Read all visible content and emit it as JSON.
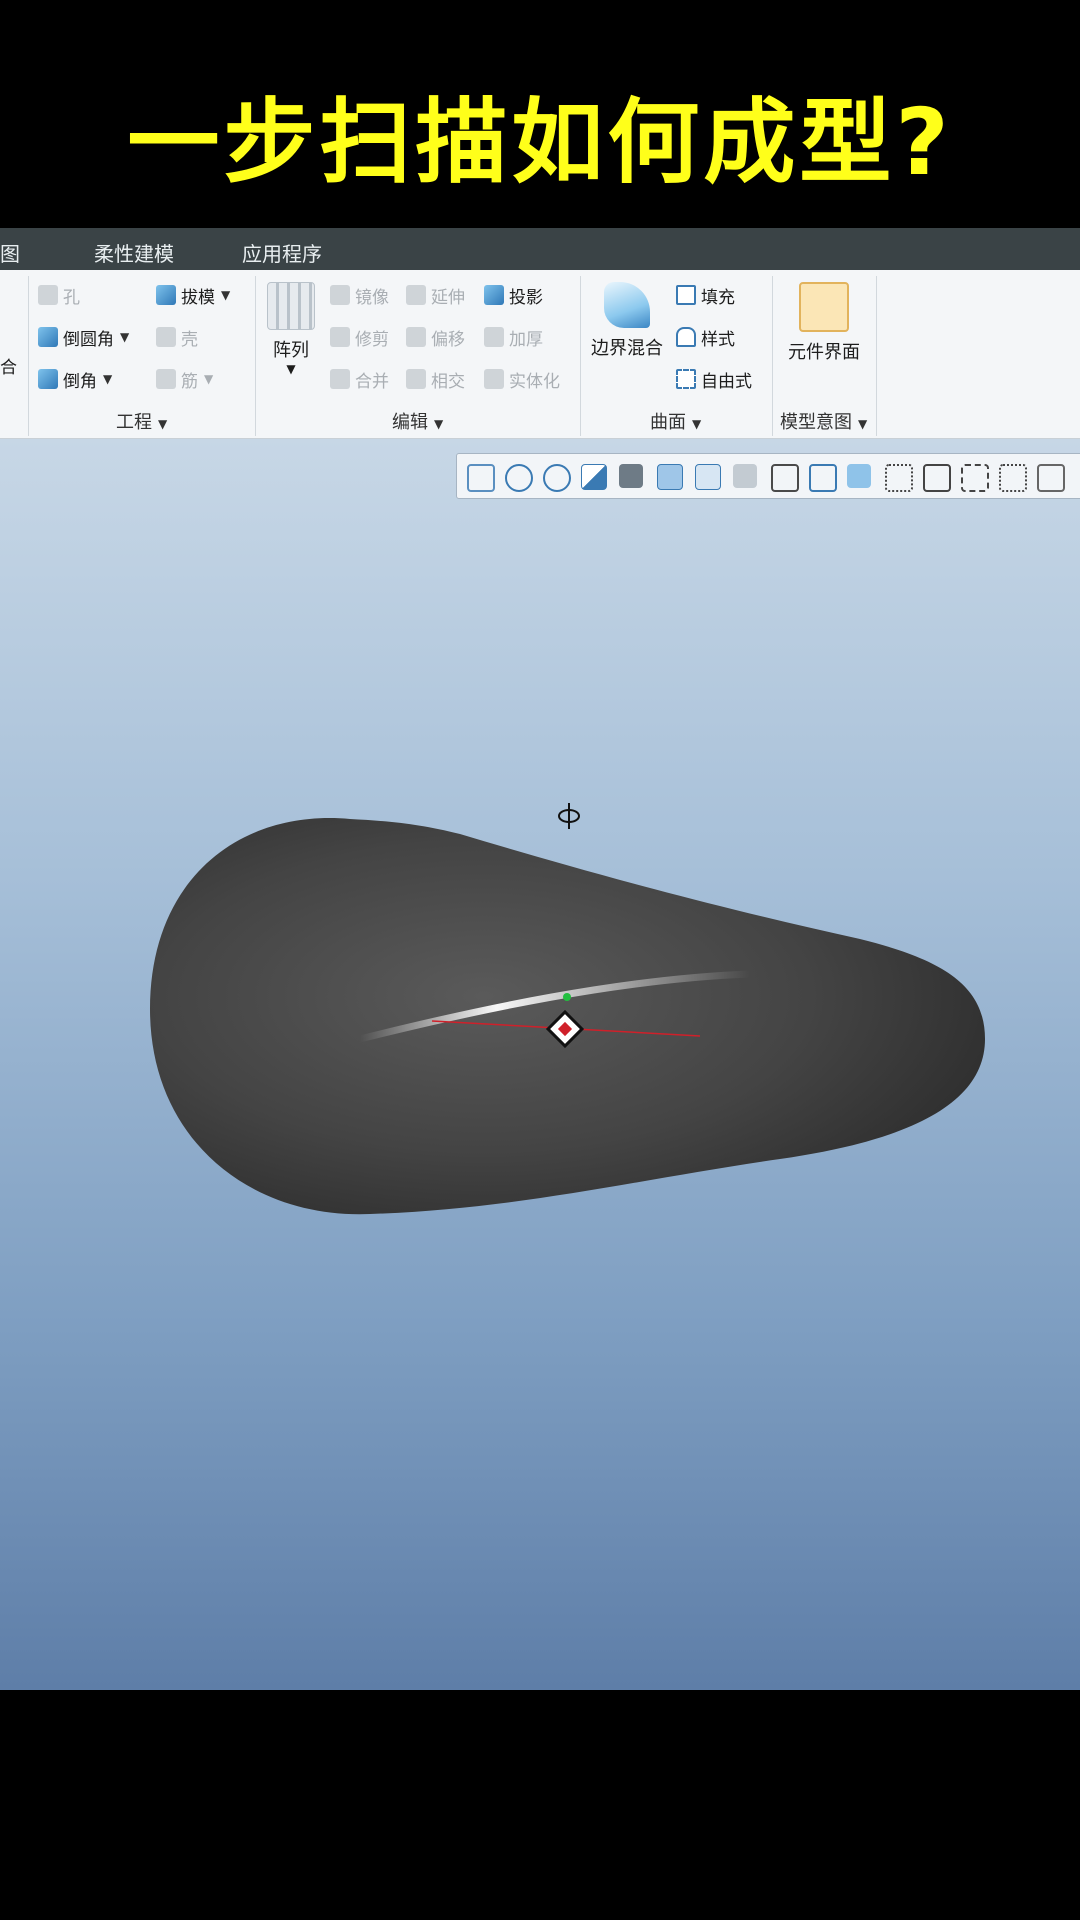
{
  "overlay": {
    "title": "一步扫描如何成型?"
  },
  "tabs": [
    {
      "label": "图"
    },
    {
      "label": "柔性建模"
    },
    {
      "label": "应用程序"
    }
  ],
  "ribbon": {
    "engineering": {
      "label": "工程",
      "cut_label": "合",
      "hole": "孔",
      "draft": "拔模",
      "round": "倒圆角",
      "shell": "壳",
      "chamfer": "倒角",
      "rib": "筋"
    },
    "editing": {
      "label": "编辑",
      "pattern": "阵列",
      "mirror": "镜像",
      "extend": "延伸",
      "project": "投影",
      "trim": "修剪",
      "offset": "偏移",
      "thicken": "加厚",
      "merge": "合并",
      "intersect": "相交",
      "solidify": "实体化"
    },
    "surfaces": {
      "label": "曲面",
      "boundary_blend": "边界混合",
      "fill": "填充",
      "style": "样式",
      "freestyle": "自由式"
    },
    "model_intent": {
      "label": "模型意图",
      "component_interface": "元件界面"
    }
  },
  "colors": {
    "title_yellow": "#ffff1a",
    "tabbar_bg": "#3a4346",
    "ribbon_bg": "#f4f6f8",
    "viewport_top": "#c7d7e6",
    "viewport_bottom": "#5e7ea8",
    "model_grey": "#4a4a4a"
  }
}
